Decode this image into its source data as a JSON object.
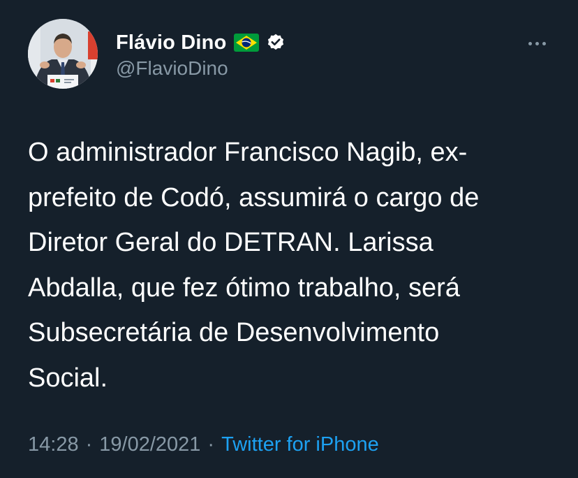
{
  "author": {
    "display_name": "Flávio Dino",
    "flag_icon": "brazil-flag-icon",
    "verified_icon": "verified-badge-icon",
    "handle": "@FlavioDino"
  },
  "more_icon": "more-options-icon",
  "tweet": {
    "text": "O administrador Francisco Nagib, ex-\nprefeito de Codó, assumirá o cargo de\nDiretor Geral do DETRAN. Larissa\nAbdalla, que fez ótimo trabalho, será\nSubsecretária de Desenvolvimento\nSocial.",
    "time": "14:28",
    "separator": "·",
    "date": "19/02/2021",
    "source": "Twitter for iPhone"
  },
  "colors": {
    "background": "#15202b",
    "text": "#ffffff",
    "secondary": "#8899a6",
    "link": "#1da1f2"
  }
}
